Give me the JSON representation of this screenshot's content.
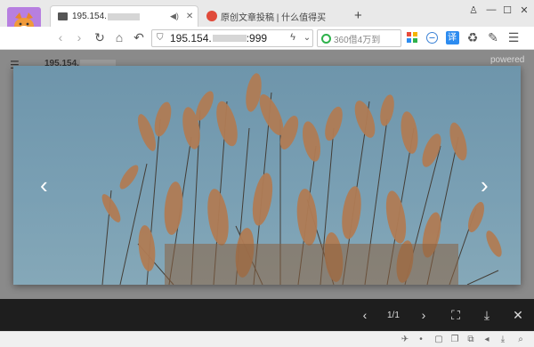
{
  "tabs": [
    {
      "label": "195.154.",
      "icon": "folder-icon",
      "active": true
    },
    {
      "label": "原创文章投稿 | 什么值得买",
      "icon": "smzdm-logo-icon",
      "active": false
    }
  ],
  "new_tab_label": "+",
  "address": {
    "host": "195.154.",
    "port": ":999"
  },
  "search": {
    "placeholder": "360借4万到"
  },
  "header": {
    "title": "195.154.",
    "powered": "powered"
  },
  "lightbox": {
    "counter": "1/1"
  },
  "colors": {
    "sky": "#7aa0b4",
    "reed": "#b07c55",
    "lightbox_bar": "#1e1e1e"
  }
}
